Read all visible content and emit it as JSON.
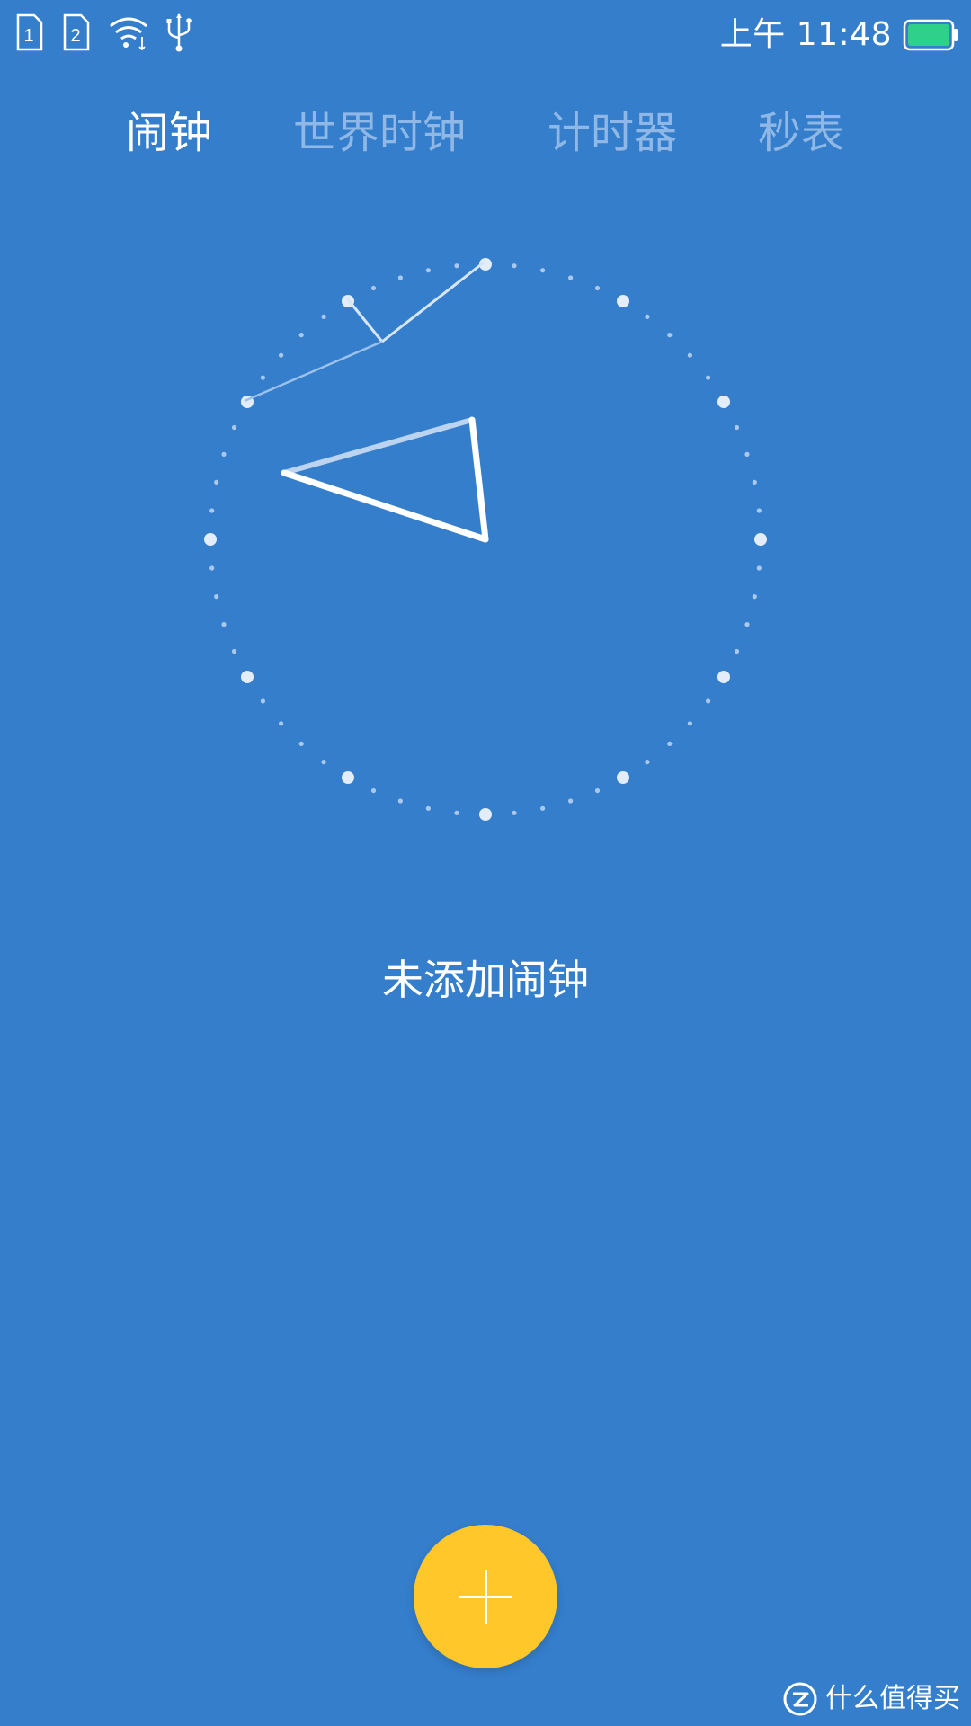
{
  "status_bar": {
    "sim1_label": "1",
    "sim2_label": "2",
    "icons": [
      "sim-card-icon",
      "sim-card-icon",
      "wifi-icon",
      "usb-icon",
      "battery-icon"
    ],
    "time": "上午 11:48",
    "battery_color": "#2ED08A"
  },
  "tabs": [
    {
      "label": "闹钟",
      "active": true
    },
    {
      "label": "世界时钟",
      "active": false
    },
    {
      "label": "计时器",
      "active": false
    },
    {
      "label": "秒表",
      "active": false
    }
  ],
  "main": {
    "empty_message": "未添加闹钟"
  },
  "fab": {
    "icon": "plus-icon",
    "color": "#FFC72A"
  },
  "watermark": {
    "text": "什么值得买",
    "icon": "zhi-logo-icon"
  },
  "colors": {
    "background": "#357ECC",
    "tab_inactive": "#8FB8E6"
  }
}
